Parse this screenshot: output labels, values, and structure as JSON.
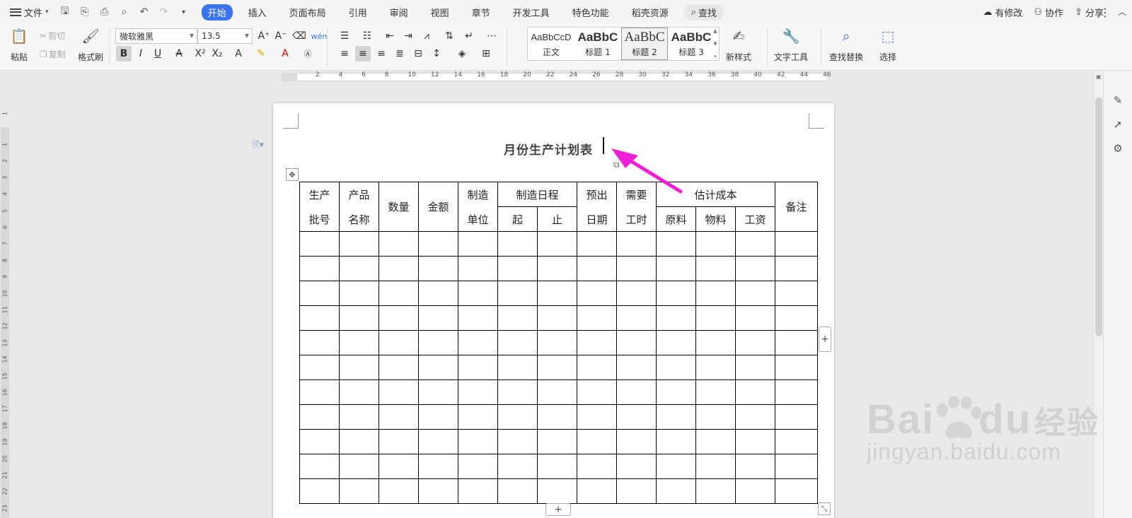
{
  "menu": {
    "file": "文件",
    "tabs": [
      "开始",
      "插入",
      "页面布局",
      "引用",
      "审阅",
      "视图",
      "章节",
      "开发工具",
      "特色功能",
      "稻壳资源"
    ],
    "active_tab": "开始",
    "search": "查找",
    "right": {
      "modified": "有修改",
      "collab": "协作",
      "share": "分享"
    }
  },
  "ribbon": {
    "paste": "粘贴",
    "cut": "剪切",
    "copy": "复制",
    "format_painter": "格式刷",
    "font_name": "微软雅黑",
    "font_size": "13.5",
    "styles": [
      {
        "preview": "AaBbCcD",
        "name": "正文"
      },
      {
        "preview": "AaBbC",
        "name": "标题 1"
      },
      {
        "preview": "AaBbC",
        "name": "标题 2"
      },
      {
        "preview": "AaBbC",
        "name": "标题 3"
      }
    ],
    "new_style": "新样式",
    "text_tools": "文字工具",
    "find_replace": "查找替换",
    "select": "选择"
  },
  "ruler": {
    "h_ticks": [
      "2",
      "4",
      "6",
      "8",
      "10",
      "12",
      "14",
      "16",
      "18",
      "20",
      "22",
      "24",
      "26",
      "28",
      "30",
      "32",
      "34",
      "36",
      "38",
      "40",
      "42",
      "44",
      "46"
    ],
    "v_ticks": [
      "1",
      "1",
      "2",
      "3",
      "4",
      "5",
      "6",
      "7",
      "8",
      "9",
      "10",
      "11",
      "12",
      "13",
      "14",
      "15",
      "16",
      "17",
      "18",
      "19",
      "20",
      "21",
      "22",
      "23"
    ]
  },
  "document": {
    "title": "月份生产计划表",
    "table": {
      "header_row1": {
        "batch": [
          "生产",
          "批号"
        ],
        "product": [
          "产品",
          "名称"
        ],
        "quantity": "数量",
        "amount": "金额",
        "unit": [
          "制造",
          "单位"
        ],
        "schedule": "制造日程",
        "expected": [
          "预出",
          "日期"
        ],
        "hours": [
          "需要",
          "工时"
        ],
        "cost": "估计成本",
        "remark": "备注"
      },
      "header_row2": {
        "start": "起",
        "end": "止",
        "material": "原料",
        "goods": "物料",
        "wage": "工资"
      },
      "empty_rows": 11
    }
  },
  "watermark": {
    "brand_latin": "Bai",
    "brand_du": "du",
    "brand_cn": "经验",
    "url": "jingyan.baidu.com"
  },
  "colors": {
    "accent": "#3b73f0",
    "arrow": "#ee1fd6"
  }
}
